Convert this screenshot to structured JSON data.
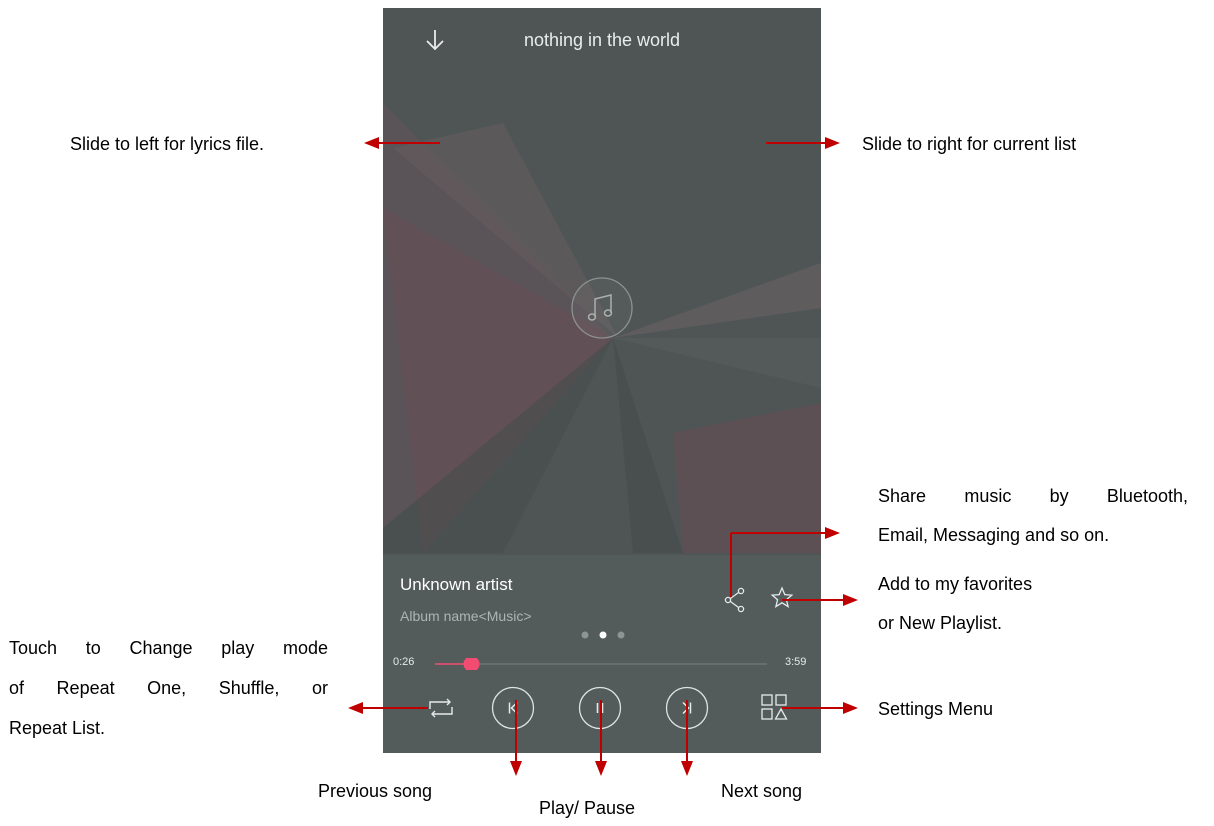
{
  "player": {
    "title": "nothing in the world",
    "artist": "Unknown artist",
    "album": "Album name<Music>",
    "time_elapsed": "0:26",
    "time_total": "3:59",
    "progress_fraction": 0.11,
    "page_dots": {
      "count": 3,
      "active_index": 1
    },
    "accent_color": "#f24c73",
    "background_color": "#4f5555",
    "icons": [
      "arrow-down-icon",
      "music-note-icon",
      "share-icon",
      "star-icon",
      "repeat-icon",
      "previous-icon",
      "pause-icon",
      "next-icon",
      "settings-grid-icon"
    ]
  },
  "annotations": {
    "lyrics": "Slide to left for lyrics file.",
    "current_list": "Slide to right for current list",
    "share_line1": "Share music by Bluetooth,",
    "share_line2": "Email, Messaging and so on.",
    "favorites_line1": "Add to my favorites",
    "favorites_line2": "or New Playlist.",
    "play_mode_line1": "Touch to Change play mode",
    "play_mode_line2": "of Repeat One, Shuffle, or",
    "play_mode_line3": "Repeat List.",
    "settings": "Settings Menu",
    "previous": "Previous song",
    "play_pause": "Play/ Pause",
    "next": "Next song",
    "arrow_color": "#c00000"
  }
}
